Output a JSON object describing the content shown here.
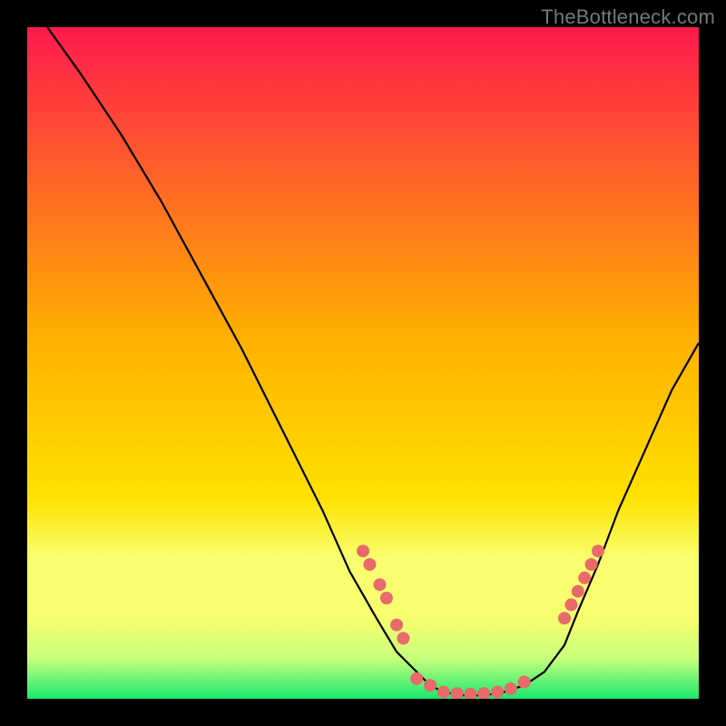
{
  "watermark": "TheBottleneck.com",
  "colors": {
    "top": "#ff1a4e",
    "mid": "#ffd400",
    "lightYellow": "#f7ff6e",
    "paleGreen": "#c7ff7a",
    "green": "#19e86f",
    "curve": "#000000",
    "dot": "#e86a6a",
    "background": "#000000"
  },
  "chart_data": {
    "type": "line",
    "title": "",
    "xlabel": "",
    "ylabel": "",
    "xlim": [
      0,
      100
    ],
    "ylim": [
      0,
      100
    ],
    "notes": "No axis ticks or numeric labels are rendered; values are read as percentages of the visible plot box.",
    "series": [
      {
        "name": "curve",
        "x": [
          3,
          8,
          14,
          20,
          26,
          32,
          38,
          44,
          48,
          52,
          55,
          58,
          60,
          62,
          65,
          68,
          71,
          74,
          77,
          80,
          82,
          85,
          88,
          92,
          96,
          100
        ],
        "y": [
          100,
          93,
          84,
          74,
          63,
          52,
          40,
          28,
          19,
          12,
          7,
          4,
          2,
          1,
          0.5,
          0.5,
          1,
          2,
          4,
          8,
          13,
          20,
          28,
          37,
          46,
          53
        ]
      }
    ],
    "markers": [
      {
        "name": "left-cluster",
        "points": [
          {
            "x": 50,
            "y": 22
          },
          {
            "x": 51,
            "y": 20
          },
          {
            "x": 52.5,
            "y": 17
          },
          {
            "x": 53.5,
            "y": 15
          },
          {
            "x": 55,
            "y": 11
          },
          {
            "x": 56,
            "y": 9
          }
        ]
      },
      {
        "name": "bottom-cluster",
        "points": [
          {
            "x": 58,
            "y": 3
          },
          {
            "x": 60,
            "y": 2
          },
          {
            "x": 62,
            "y": 1
          },
          {
            "x": 64,
            "y": 0.8
          },
          {
            "x": 66,
            "y": 0.7
          },
          {
            "x": 68,
            "y": 0.8
          },
          {
            "x": 70,
            "y": 1
          },
          {
            "x": 72,
            "y": 1.5
          },
          {
            "x": 74,
            "y": 2.5
          }
        ]
      },
      {
        "name": "right-cluster",
        "points": [
          {
            "x": 80,
            "y": 12
          },
          {
            "x": 81,
            "y": 14
          },
          {
            "x": 82,
            "y": 16
          },
          {
            "x": 83,
            "y": 18
          },
          {
            "x": 84,
            "y": 20
          },
          {
            "x": 85,
            "y": 22
          }
        ]
      }
    ]
  }
}
